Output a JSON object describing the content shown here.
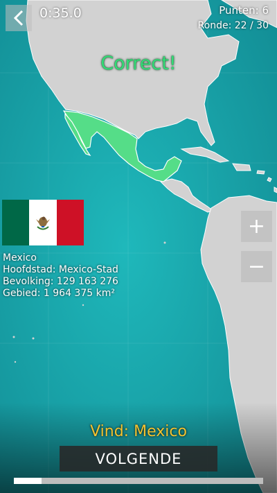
{
  "hud": {
    "timer": "0:35.0",
    "score_text": "Punten: 6",
    "round_text": "Ronde: 22 / 30",
    "back_icon": "chevron-left-icon"
  },
  "feedback": {
    "text": "Correct!",
    "color": "#33dd77"
  },
  "country": {
    "name": "Mexico",
    "capital": "Hoofdstad: Mexico-Stad",
    "population": "Bevolking: 129 163 276",
    "area": "Gebied: 1 964 375 km²",
    "flag_colors": [
      "#006847",
      "#ffffff",
      "#ce1126"
    ],
    "emblem_icon": "eagle-emblem-icon"
  },
  "zoom": {
    "in_label": "+",
    "out_label": "−"
  },
  "prompt": {
    "text": "Vind: Mexico",
    "color": "#f2c230"
  },
  "next_button": {
    "label": "VOLGENDE"
  },
  "progress": {
    "fraction": 0.11
  },
  "map_colors": {
    "ocean": "#1aa3a8",
    "land": "#d2d2d2",
    "highlight": "#55dd88",
    "border": "#ffffff"
  }
}
